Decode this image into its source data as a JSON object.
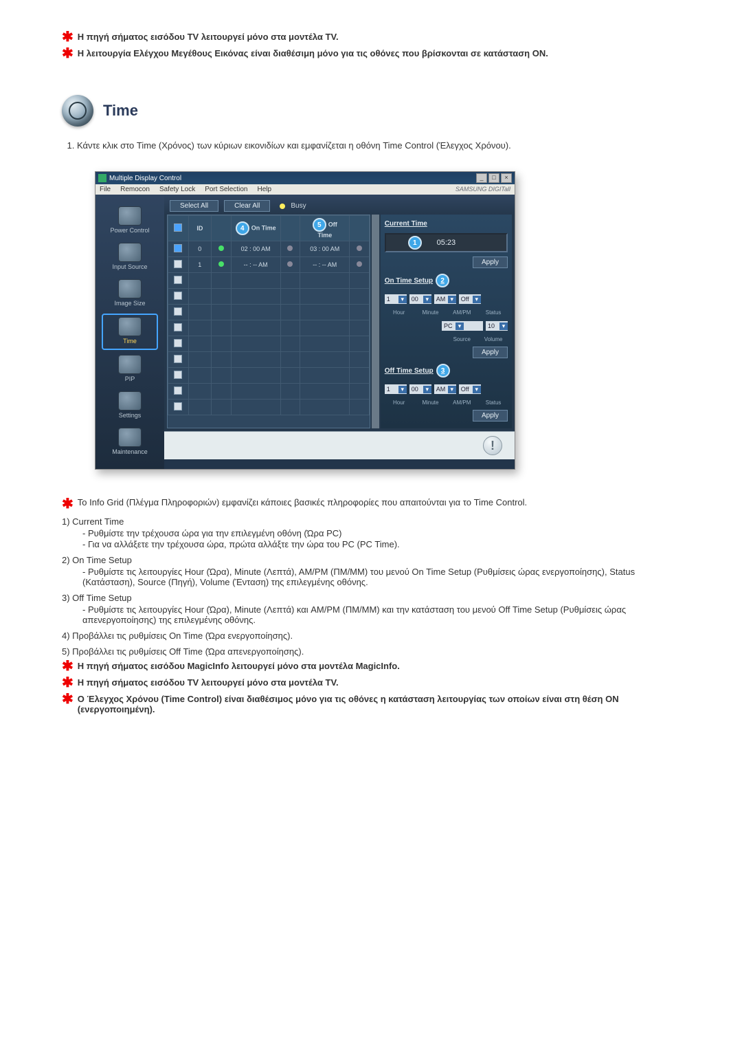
{
  "top_notes": [
    "Η πηγή σήματος εισόδου TV λειτουργεί μόνο στα μοντέλα TV.",
    "Η λειτουργία Ελέγχου Μεγέθους Εικόνας είναι διαθέσιμη μόνο για τις οθόνες που βρίσκονται σε κατάσταση ON."
  ],
  "section": {
    "title": "Time"
  },
  "intro_list": [
    "Κάντε κλικ στο Time (Χρόνος) των κύριων εικονιδίων και εμφανίζεται η οθόνη Time Control (Έλεγχος Χρόνου)."
  ],
  "app": {
    "title": "Multiple Display Control",
    "menu": [
      "File",
      "Remocon",
      "Safety Lock",
      "Port Selection",
      "Help"
    ],
    "brand": "SAMSUNG DIGITall",
    "sidebar": [
      {
        "label": "Power Control"
      },
      {
        "label": "Input Source"
      },
      {
        "label": "Image Size"
      },
      {
        "label": "Time"
      },
      {
        "label": "PIP"
      },
      {
        "label": "Settings"
      },
      {
        "label": "Maintenance"
      }
    ],
    "toolbar": {
      "select_all": "Select All",
      "clear_all": "Clear All",
      "busy": "Busy"
    },
    "grid": {
      "headers": {
        "chk": "",
        "id": "ID",
        "lamp": "",
        "on_time": "On Time",
        "on_lamp": "",
        "off_time": "Off Time",
        "off_lamp": ""
      },
      "badge_on": "4",
      "badge_off": "5",
      "rows": [
        {
          "chk": true,
          "id": "0",
          "lamp": "green",
          "on_time": "02 : 00 AM",
          "on_lamp": "grey",
          "off_time": "03 : 00 AM",
          "off_lamp": "grey"
        },
        {
          "chk": false,
          "id": "1",
          "lamp": "green",
          "on_time": "-- : -- AM",
          "on_lamp": "grey",
          "off_time": "-- : -- AM",
          "off_lamp": "grey"
        }
      ],
      "empty_rows": 9
    },
    "right": {
      "current_time_title": "Current Time",
      "current_time_badge": "1",
      "current_time_value": "05:23",
      "apply": "Apply",
      "on_time_title": "On Time Setup",
      "on_time_badge": "2",
      "on": {
        "hour": "1",
        "minute": "00",
        "ampm": "AM",
        "status": "Off",
        "source": "PC",
        "volume": "10",
        "lbl_hour": "Hour",
        "lbl_minute": "Minute",
        "lbl_ampm": "AM/PM",
        "lbl_status": "Status",
        "lbl_source": "Source",
        "lbl_volume": "Volume"
      },
      "off_time_title": "Off Time Setup",
      "off_time_badge": "3",
      "off": {
        "hour": "1",
        "minute": "00",
        "ampm": "AM",
        "status": "Off",
        "lbl_hour": "Hour",
        "lbl_minute": "Minute",
        "lbl_ampm": "AM/PM",
        "lbl_status": "Status"
      }
    }
  },
  "body": {
    "info_grid_note": "Το Info Grid (Πλέγμα Πληροφοριών) εμφανίζει κάποιες βασικές πληροφορίες που απαιτούνται για το Time Control.",
    "n1": "1) Current Time",
    "n1a": "- Ρυθμίστε την τρέχουσα ώρα για την επιλεγμένη οθόνη (Ώρα PC)",
    "n1b": "- Για να αλλάξετε την τρέχουσα ώρα, πρώτα αλλάξτε την ώρα του PC (PC Time).",
    "n2": "2) On Time Setup",
    "n2a": "- Ρυθμίστε τις λειτουργίες Hour (Ώρα), Minute (Λεπτά), AM/PM (ΠΜ/ΜΜ) του μενού On Time Setup (Ρυθμίσεις ώρας ενεργοποίησης), Status (Κατάσταση), Source (Πηγή), Volume (Ένταση) της επιλεγμένης οθόνης.",
    "n3": "3) Off Time Setup",
    "n3a": "- Ρυθμίστε τις λειτουργίες Hour (Ώρα), Minute (Λεπτά) και AM/PM (ΠΜ/ΜΜ) και την κατάσταση του μενού Off Time Setup (Ρυθμίσεις ώρας απενεργοποίησης) της επιλεγμένης οθόνης.",
    "n4": "4) Προβάλλει τις ρυθμίσεις On Time (Ώρα ενεργοποίησης).",
    "n5": "5) Προβάλλει τις ρυθμίσεις Off Time (Ώρα απενεργοποίησης)."
  },
  "bottom_notes": [
    "Η πηγή σήματος εισόδου MagicInfo λειτουργεί μόνο στα μοντέλα MagicInfo.",
    "Η πηγή σήματος εισόδου TV λειτουργεί μόνο στα μοντέλα TV.",
    "Ο Έλεγχος Χρόνου (Time Control) είναι διαθέσιμος μόνο για τις οθόνες η κατάσταση λειτουργίας των οποίων είναι στη θέση ON (ενεργοποιημένη)."
  ]
}
